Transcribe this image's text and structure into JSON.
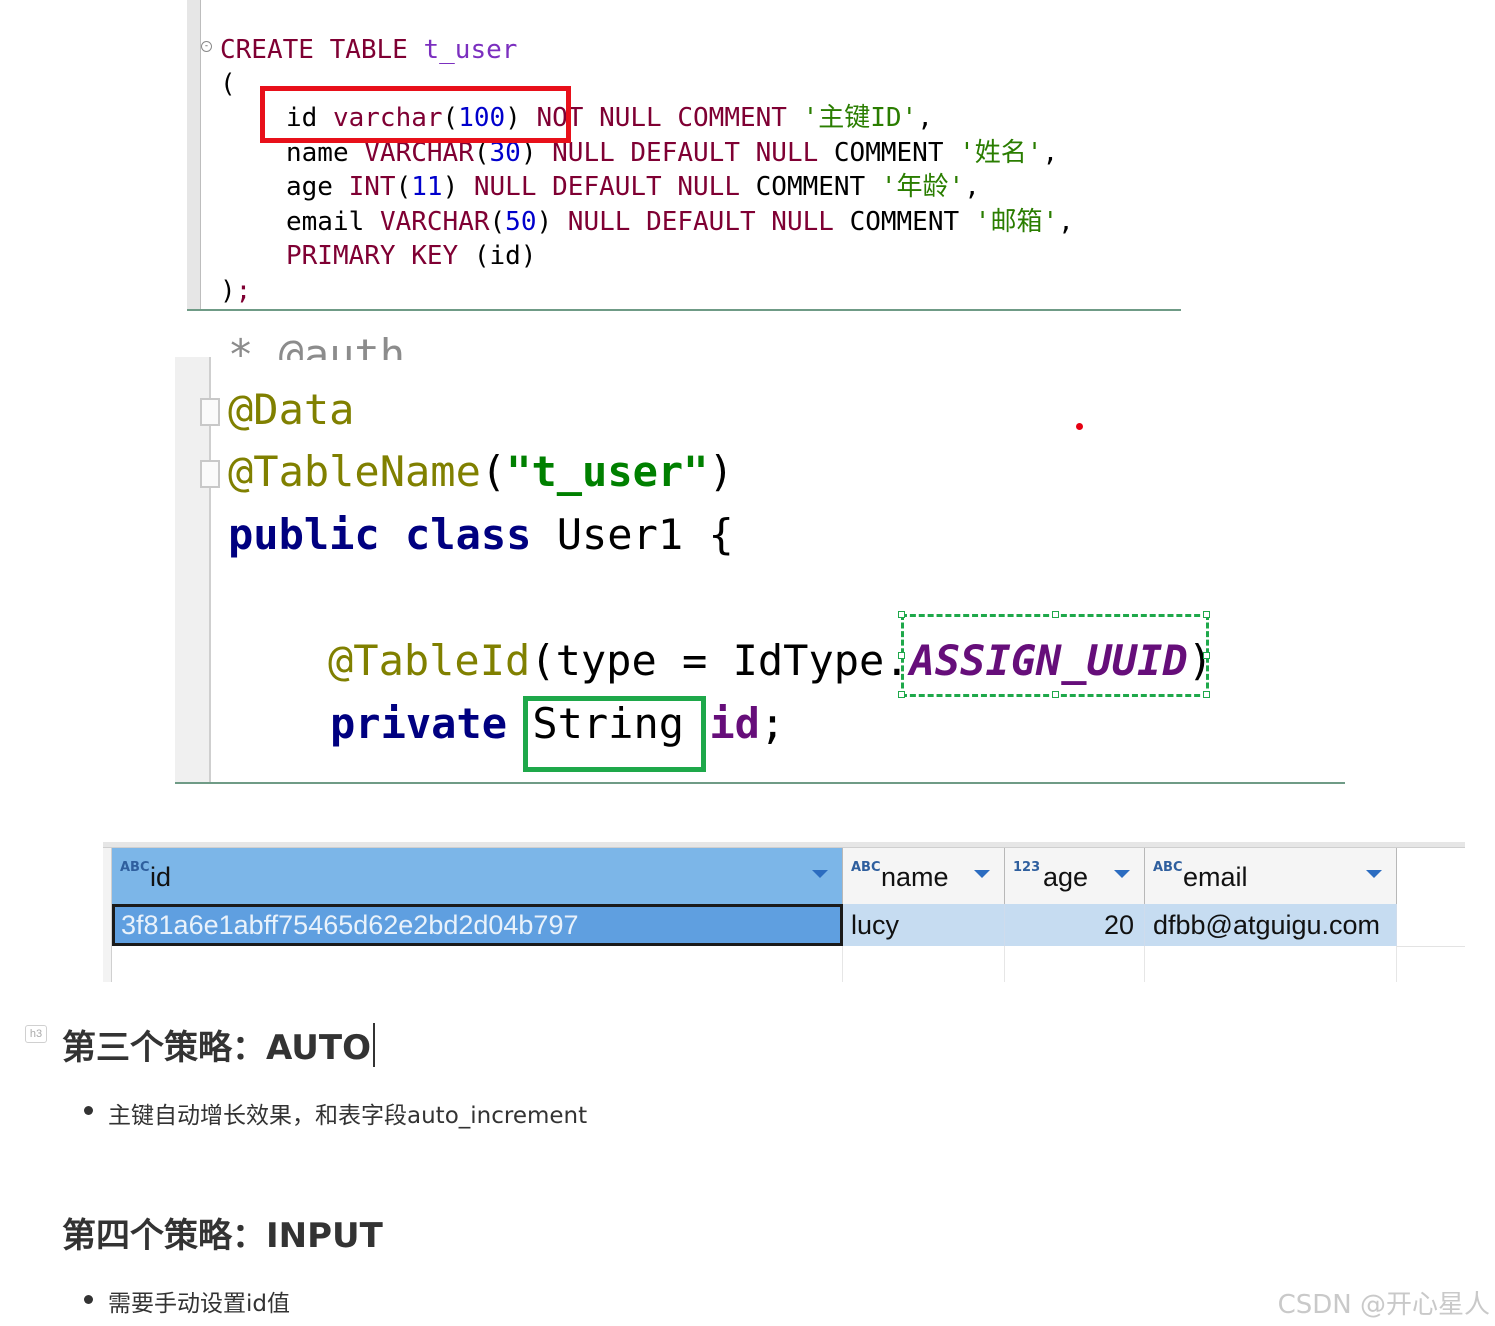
{
  "sql_editor": {
    "fold_icon": "minus-icon",
    "line1": {
      "kw": "CREATE TABLE",
      "table": "t_user"
    },
    "line2": "(",
    "line3": {
      "col": "id",
      "type": "varchar",
      "open": "(",
      "num": "100",
      "close": ")",
      "rest": "NOT NULL COMMENT",
      "comment": "'主键ID'",
      "tail": ","
    },
    "line4": {
      "col": "name",
      "type": "VARCHAR",
      "open": "(",
      "num": "30",
      "close": ")",
      "rest": "NULL DEFAULT NULL",
      "rest2": "COMMENT",
      "comment": "'姓名'",
      "tail": ","
    },
    "line5": {
      "col": "age",
      "type": "INT",
      "open": "(",
      "num": "11",
      "close": ")",
      "rest": "NULL DEFAULT NULL",
      "rest2": "COMMENT",
      "comment": "'年龄'",
      "tail": ","
    },
    "line6": {
      "col": "email",
      "type": "VARCHAR",
      "open": "(",
      "num": "50",
      "close": ")",
      "rest": "NULL DEFAULT NULL",
      "rest2": "COMMENT",
      "comment": "'邮箱'",
      "tail": ","
    },
    "line7": {
      "kw": "PRIMARY KEY",
      "rest": "(id)"
    },
    "line8": {
      "paren": ")",
      "semi": ";"
    }
  },
  "java_editor": {
    "cut_text": "* @auth",
    "line1": "@Data",
    "line2": {
      "ann": "@TableName",
      "open": "(",
      "str": "\"t_user\"",
      "close": ")"
    },
    "line3": {
      "kw": "public class",
      "name": "User1 {"
    },
    "line4": {
      "ann": "@TableId",
      "args": "(type = IdType.",
      "enum": "ASSIGN_UUID",
      "close": ")"
    },
    "line5": {
      "kw": "private",
      "type": "String",
      "field": "id",
      "semi": ";"
    }
  },
  "result_grid": {
    "columns": [
      {
        "type_icon": "ABC",
        "label": "id"
      },
      {
        "type_icon": "ABC",
        "label": "name"
      },
      {
        "type_icon": "123",
        "label": "age"
      },
      {
        "type_icon": "ABC",
        "label": "email"
      }
    ],
    "row": {
      "id": "3f81a6e1abff75465d62e2bd2d04b797",
      "name": "lucy",
      "age": "20",
      "email": "dfbb@atguigu.com"
    }
  },
  "doc": {
    "h3_tag": "h3",
    "heading3": "第三个策略：AUTO",
    "bullet3": "主键自动增长效果，和表字段auto_increment",
    "heading4": "第四个策略：INPUT",
    "bullet4": "需要手动设置id值",
    "watermark": "CSDN @开心星人"
  },
  "colors": {
    "highlight_red": "#e8101a",
    "highlight_green": "#1ea84a",
    "selected_header": "#7cb6e8",
    "selected_row": "#c6dcf1"
  }
}
